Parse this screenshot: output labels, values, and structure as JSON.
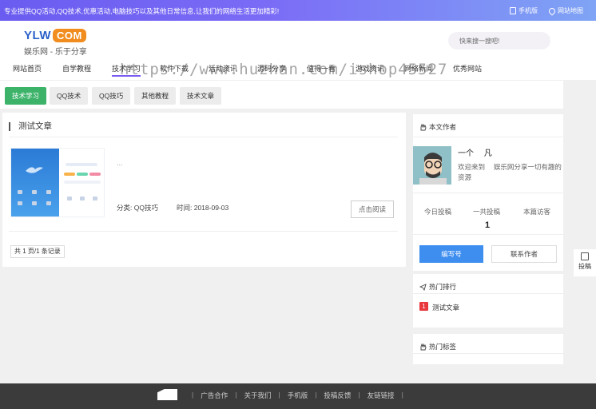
{
  "topbar": {
    "slogan": "专业提供QQ活动,QQ技术,优惠活动,电脑技巧以及其他日常信息,让我们的网络生活更加精彩!",
    "mobile_label": "手机版",
    "sitemap_label": "网站地图"
  },
  "logo": {
    "mark_a": "YLW",
    "mark_b": "COM",
    "sub": "娱乐网 - 乐于分享"
  },
  "search": {
    "placeholder": "快来搜一搜吧!"
  },
  "nav": {
    "items": [
      "网站首页",
      "自学教程",
      "技术学习",
      "软件下载",
      "活动资讯",
      "源码分享",
      "值得一看",
      "游戏资讯",
      "网络新闻",
      "优秀网站"
    ],
    "active_index": 2
  },
  "watermark": "https://www.huzhan.com/ishop45527",
  "tags": [
    "技术学习",
    "QQ技术",
    "QQ技巧",
    "其他教程",
    "技术文章"
  ],
  "main": {
    "title": "测试文章",
    "excerpt": "...",
    "category": "分类: QQ技巧",
    "time": "时间: 2018-09-03",
    "read_button": "点击阅读",
    "pager": "共 1 页/1 条记录"
  },
  "author": {
    "heading": "本文作者",
    "name": "一个   凡",
    "bio": "欢迎来到   娱乐网分享一切有趣的资源",
    "stats": [
      {
        "label": "今日投稿",
        "value": ""
      },
      {
        "label": "一共投稿",
        "value": "1"
      },
      {
        "label": "本篇访客",
        "value": ""
      }
    ],
    "subscribe_button": "编写号",
    "contact_button": "联系作者"
  },
  "hot": {
    "heading": "热门排行",
    "items": [
      {
        "rank": "1",
        "title": "测试文章"
      }
    ]
  },
  "tags_card": {
    "heading": "热门标签"
  },
  "side_tab": {
    "label": "投稿"
  },
  "footer": {
    "links": [
      "广告合作",
      "关于我们",
      "手机版",
      "投稿反馈",
      "友链链接"
    ]
  },
  "colors": {
    "accent_purple": "#7b5cf0",
    "green": "#3db36a",
    "blue_button": "#3e8ef0",
    "rank_red": "#e8383d",
    "footer_bg": "#3b3b3b"
  }
}
